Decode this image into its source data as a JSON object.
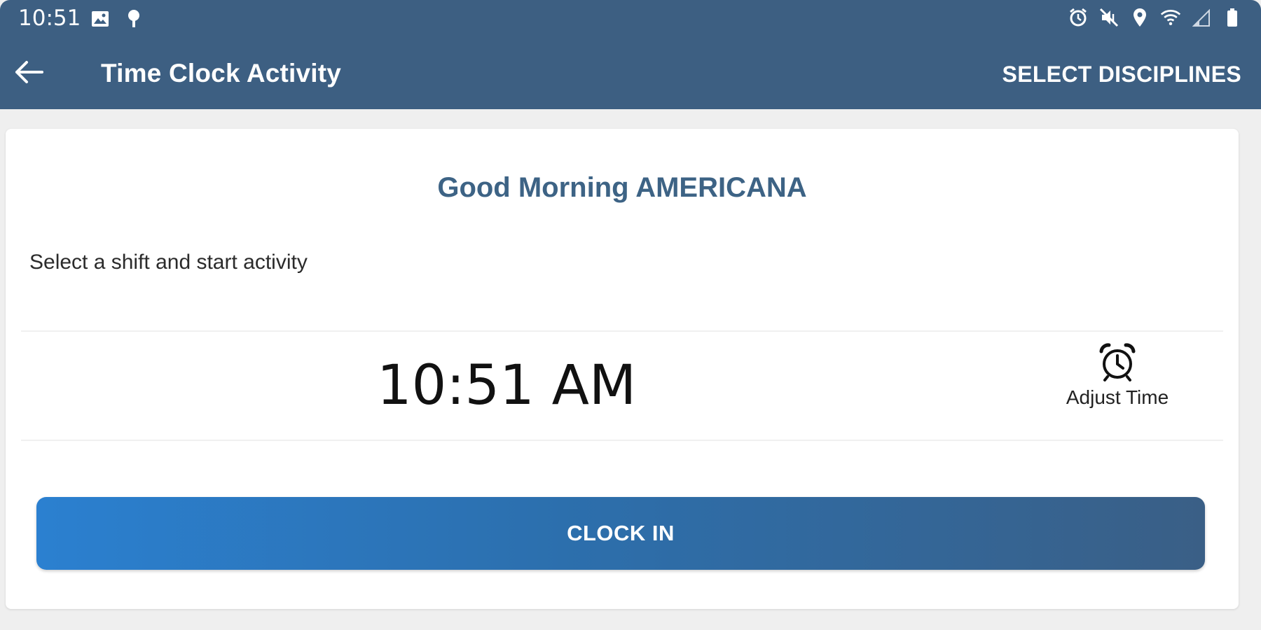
{
  "status_bar": {
    "time": "10:51",
    "left_icons": [
      "image-icon",
      "location-pin-icon"
    ],
    "right_icons": [
      "alarm-icon",
      "mute-icon",
      "location-icon",
      "wifi-icon",
      "signal-icon",
      "battery-icon"
    ]
  },
  "app_bar": {
    "title": "Time Clock Activity",
    "action_label": "SELECT DISCIPLINES",
    "back_icon": "arrow-back-icon"
  },
  "card": {
    "greeting": "Good Morning AMERICANA",
    "instruction": "Select a shift and start activity",
    "current_time": "10:51 AM",
    "adjust_label": "Adjust Time",
    "adjust_icon": "alarm-clock-icon",
    "clock_in_label": "CLOCK IN"
  },
  "colors": {
    "app_bar": "#3d5f82",
    "greeting": "#3d6385",
    "button_start": "#2b80d0",
    "button_end": "#3a5f86",
    "background": "#efefef"
  }
}
